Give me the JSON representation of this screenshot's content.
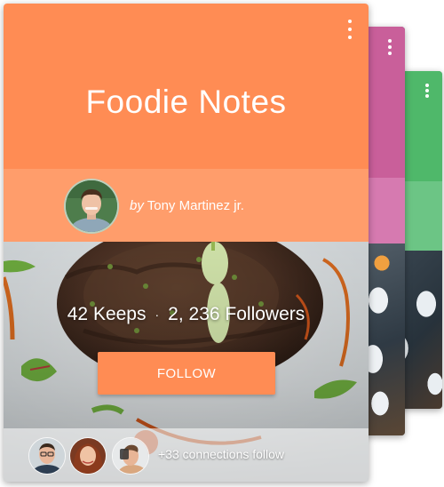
{
  "colors": {
    "front_header": "#ff8c54",
    "front_strip": "#ff9d6b",
    "follow_button": "#ff8c54",
    "pink_header": "#c95f9a",
    "pink_strip": "#d67ab0",
    "green_header": "#4fb86a",
    "green_strip": "#6cc585"
  },
  "board": {
    "title": "Foodie Notes",
    "by_prefix": "by",
    "author": "Tony Martinez jr.",
    "keeps": "42 Keeps",
    "separator": "·",
    "followers": "2, 236 Followers",
    "follow_label": "FOLLOW",
    "connections_text": "+33 connections follow"
  },
  "icons": {
    "menu": "more-vert-icon"
  }
}
